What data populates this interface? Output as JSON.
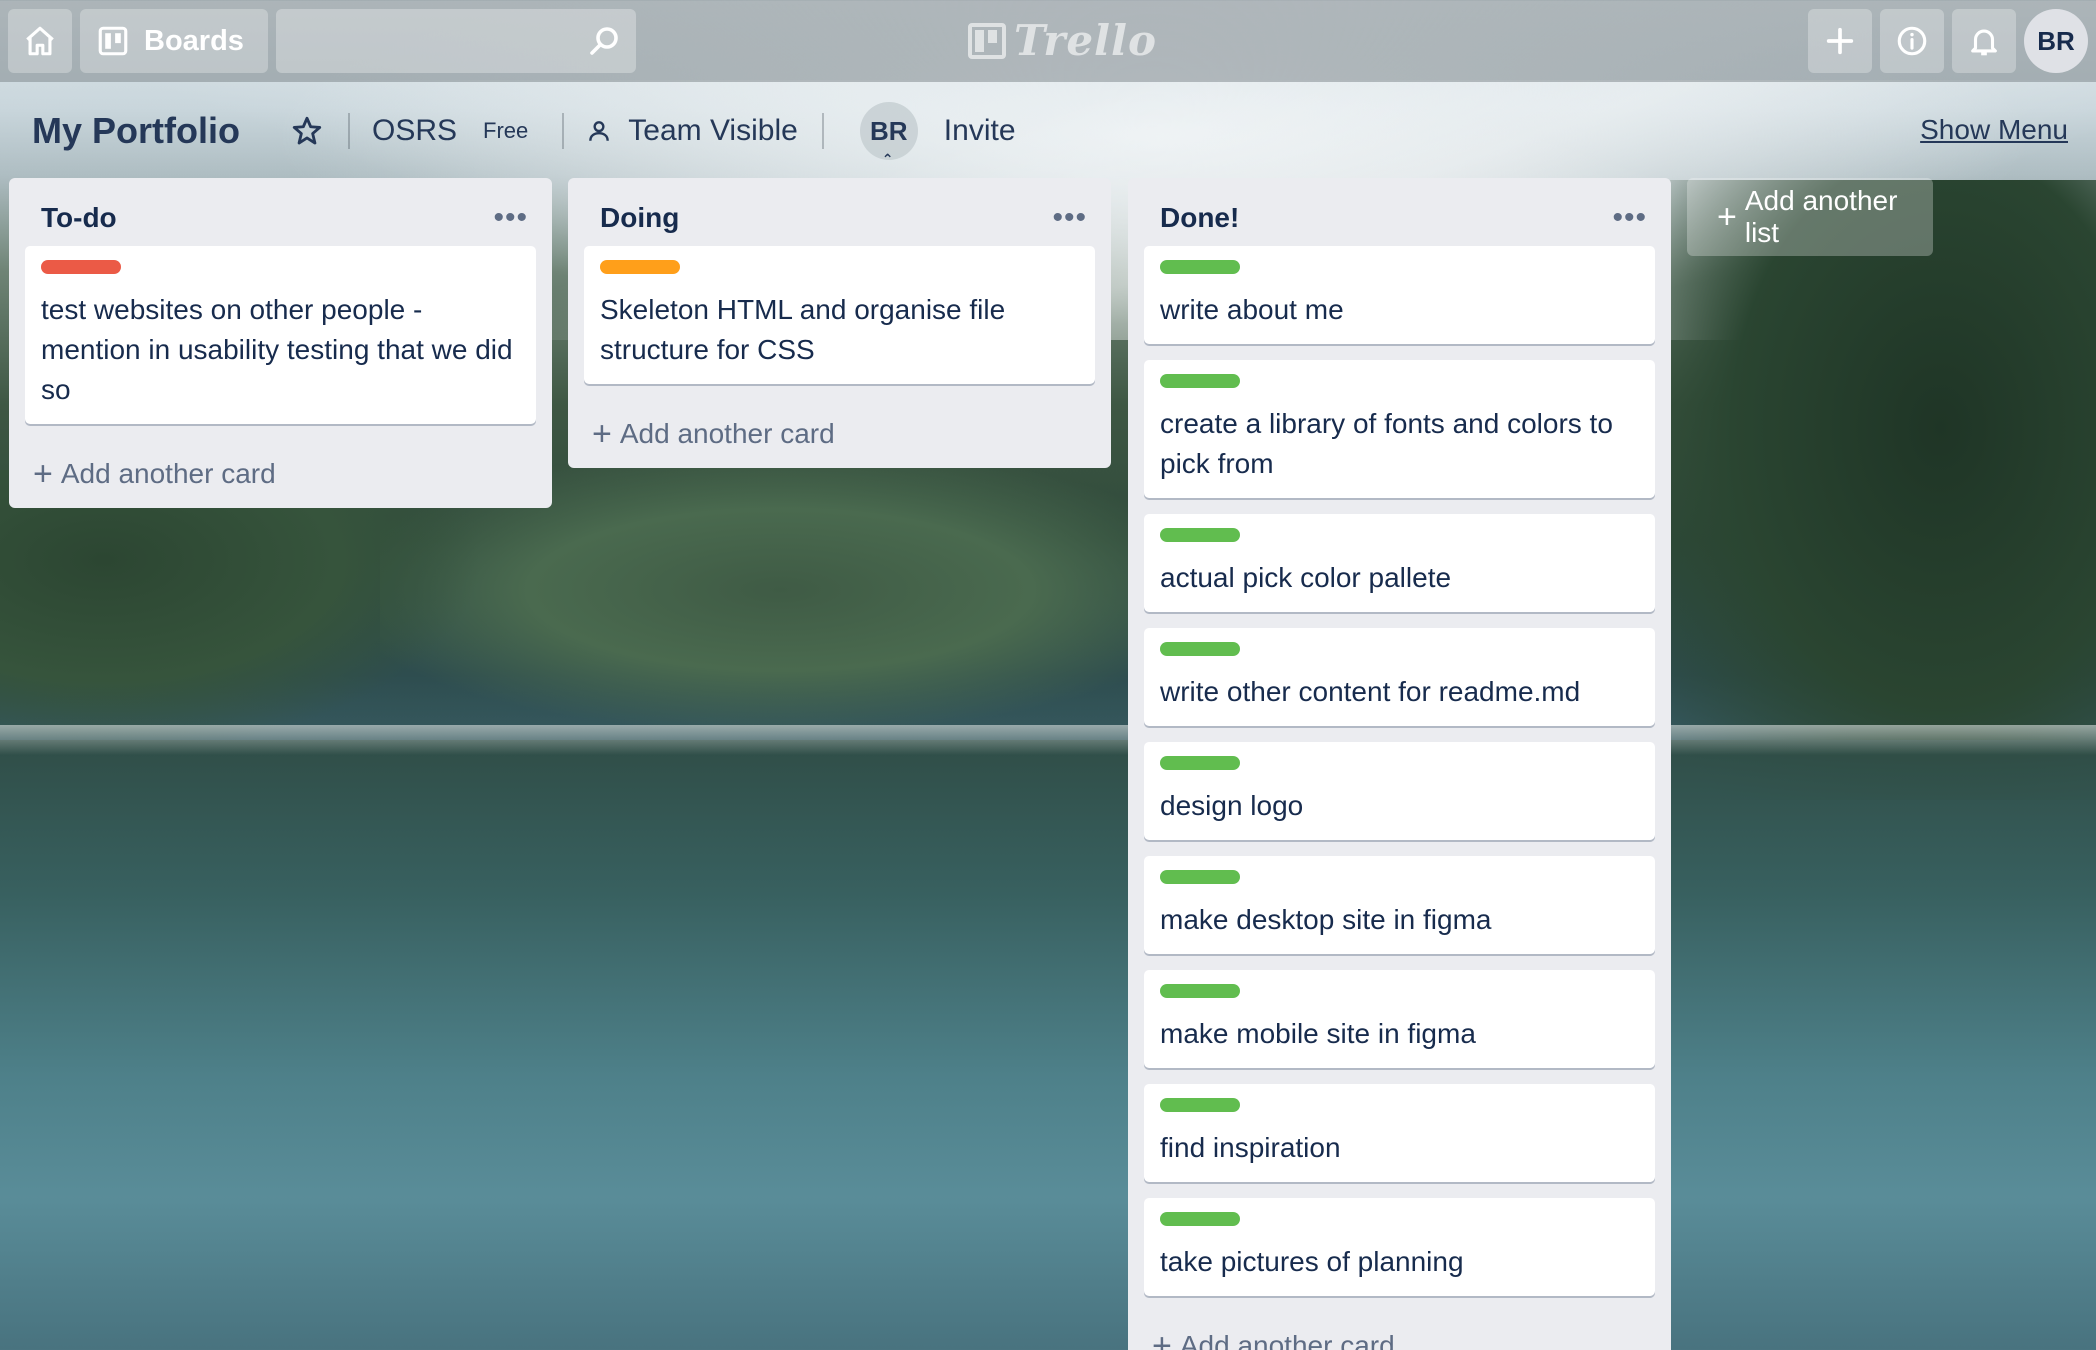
{
  "topbar": {
    "home_icon": "home-icon",
    "boards_label": "Boards",
    "search_placeholder": "",
    "logo_text": "Trello",
    "actions": [
      "plus-icon",
      "info-icon",
      "bell-icon"
    ],
    "user_initials": "BR"
  },
  "board": {
    "title": "My Portfolio",
    "team": "OSRS",
    "plan": "Free",
    "visibility": "Team Visible",
    "member_initials": "BR",
    "invite_label": "Invite",
    "show_menu_label": "Show Menu"
  },
  "lists": [
    {
      "title": "To-do",
      "cards": [
        {
          "label_color": "#eb5a46",
          "text": "test websites on other people - mention in usability testing that we did so"
        }
      ],
      "add_card_label": "Add another card"
    },
    {
      "title": "Doing",
      "cards": [
        {
          "label_color": "#ff9f1a",
          "text": "Skeleton HTML and organise file structure for CSS"
        }
      ],
      "add_card_label": "Add another card"
    },
    {
      "title": "Done!",
      "cards": [
        {
          "label_color": "#61bd4f",
          "text": "write about me"
        },
        {
          "label_color": "#61bd4f",
          "text": "create a library of fonts and colors to pick from"
        },
        {
          "label_color": "#61bd4f",
          "text": "actual pick color pallete"
        },
        {
          "label_color": "#61bd4f",
          "text": "write other content for readme.md"
        },
        {
          "label_color": "#61bd4f",
          "text": "design logo"
        },
        {
          "label_color": "#61bd4f",
          "text": "make desktop site in figma"
        },
        {
          "label_color": "#61bd4f",
          "text": "make mobile site in figma"
        },
        {
          "label_color": "#61bd4f",
          "text": "find inspiration"
        },
        {
          "label_color": "#61bd4f",
          "text": "take pictures of planning"
        }
      ],
      "add_card_label": "Add another card"
    }
  ],
  "add_list_label": "Add another list"
}
